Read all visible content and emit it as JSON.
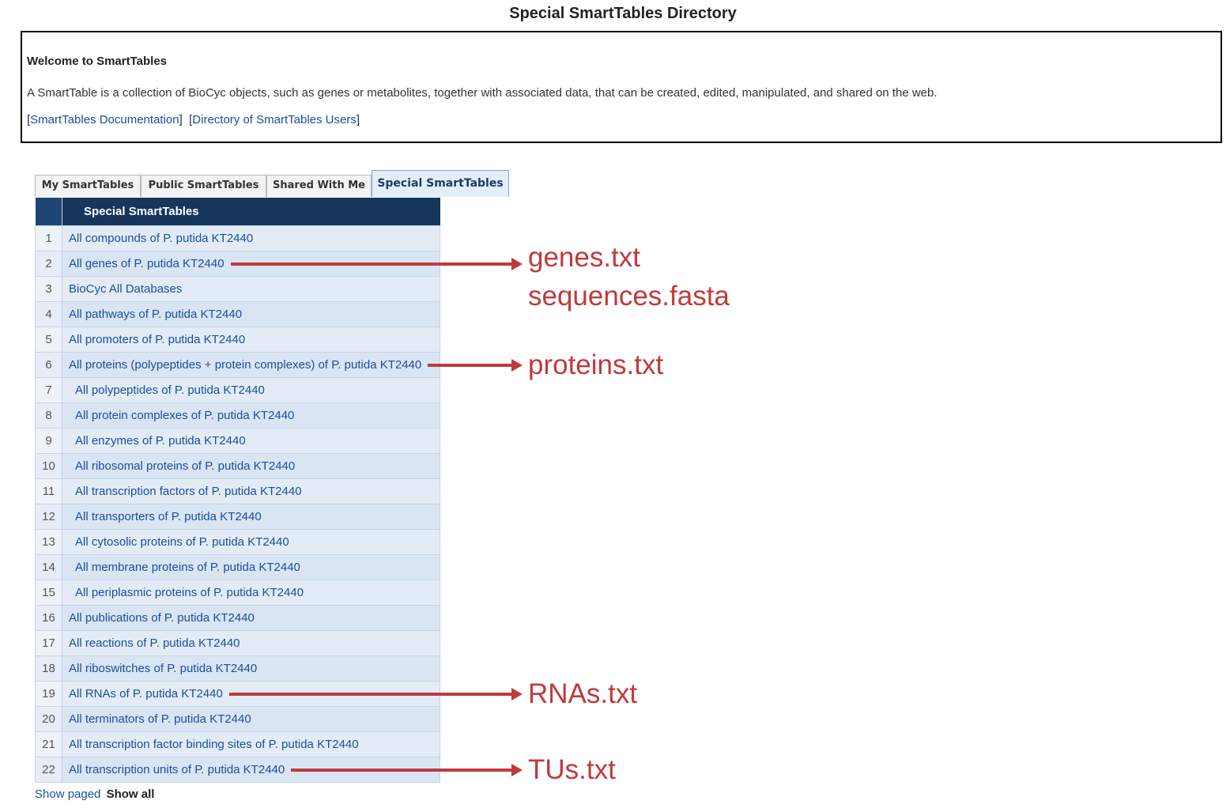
{
  "page_title": "Special SmartTables Directory",
  "welcome": {
    "title": "Welcome to SmartTables",
    "description": "A SmartTable is a collection of BioCyc objects, such as genes or metabolites, together with associated data, that can be created, edited, manipulated, and shared on the web.",
    "link_docs": "SmartTables Documentation",
    "link_users": "Directory of SmartTables Users",
    "bracket_open": "[",
    "bracket_close": "]",
    "bracket_mid": "]  ["
  },
  "tabs": [
    {
      "label": "My SmartTables",
      "active": false
    },
    {
      "label": "Public SmartTables",
      "active": false
    },
    {
      "label": "Shared With Me",
      "active": false
    },
    {
      "label": "Special SmartTables",
      "active": true
    }
  ],
  "table": {
    "header": "Special SmartTables",
    "rows": [
      {
        "num": "1",
        "label": "All compounds of P. putida KT2440",
        "indent": false
      },
      {
        "num": "2",
        "label": "All genes of P. putida KT2440",
        "indent": false
      },
      {
        "num": "3",
        "label": "BioCyc All Databases",
        "indent": false
      },
      {
        "num": "4",
        "label": "All pathways of P. putida KT2440",
        "indent": false
      },
      {
        "num": "5",
        "label": "All promoters of P. putida KT2440",
        "indent": false
      },
      {
        "num": "6",
        "label": "All proteins (polypeptides + protein complexes) of P. putida KT2440",
        "indent": false
      },
      {
        "num": "7",
        "label": "All polypeptides of P. putida KT2440",
        "indent": true
      },
      {
        "num": "8",
        "label": "All protein complexes of P. putida KT2440",
        "indent": true
      },
      {
        "num": "9",
        "label": "All enzymes of P. putida KT2440",
        "indent": true
      },
      {
        "num": "10",
        "label": "All ribosomal proteins of P. putida KT2440",
        "indent": true
      },
      {
        "num": "11",
        "label": "All transcription factors of P. putida KT2440",
        "indent": true
      },
      {
        "num": "12",
        "label": "All transporters of P. putida KT2440",
        "indent": true
      },
      {
        "num": "13",
        "label": "All cytosolic proteins of P. putida KT2440",
        "indent": true
      },
      {
        "num": "14",
        "label": "All membrane proteins of P. putida KT2440",
        "indent": true
      },
      {
        "num": "15",
        "label": "All periplasmic proteins of P. putida KT2440",
        "indent": true
      },
      {
        "num": "16",
        "label": "All publications of P. putida KT2440",
        "indent": false
      },
      {
        "num": "17",
        "label": "All reactions of P. putida KT2440",
        "indent": false
      },
      {
        "num": "18",
        "label": "All riboswitches of P. putida KT2440",
        "indent": false
      },
      {
        "num": "19",
        "label": "All RNAs of P. putida KT2440",
        "indent": false
      },
      {
        "num": "20",
        "label": "All terminators of P. putida KT2440",
        "indent": false
      },
      {
        "num": "21",
        "label": "All transcription factor binding sites of P. putida KT2440",
        "indent": false
      },
      {
        "num": "22",
        "label": "All transcription units of P. putida KT2440",
        "indent": false
      }
    ]
  },
  "show": {
    "paged": "Show paged",
    "all": "Show all"
  },
  "annotations": [
    {
      "row": "2",
      "lines": [
        "genes.txt",
        "sequences.fasta"
      ]
    },
    {
      "row": "6",
      "lines": [
        "proteins.txt"
      ]
    },
    {
      "row": "19",
      "lines": [
        "RNAs.txt"
      ]
    },
    {
      "row": "22",
      "lines": [
        "TUs.txt"
      ]
    }
  ],
  "colors": {
    "annotation": "#c0393e",
    "header_bg": "#16365c",
    "link": "#1a4fa0"
  }
}
